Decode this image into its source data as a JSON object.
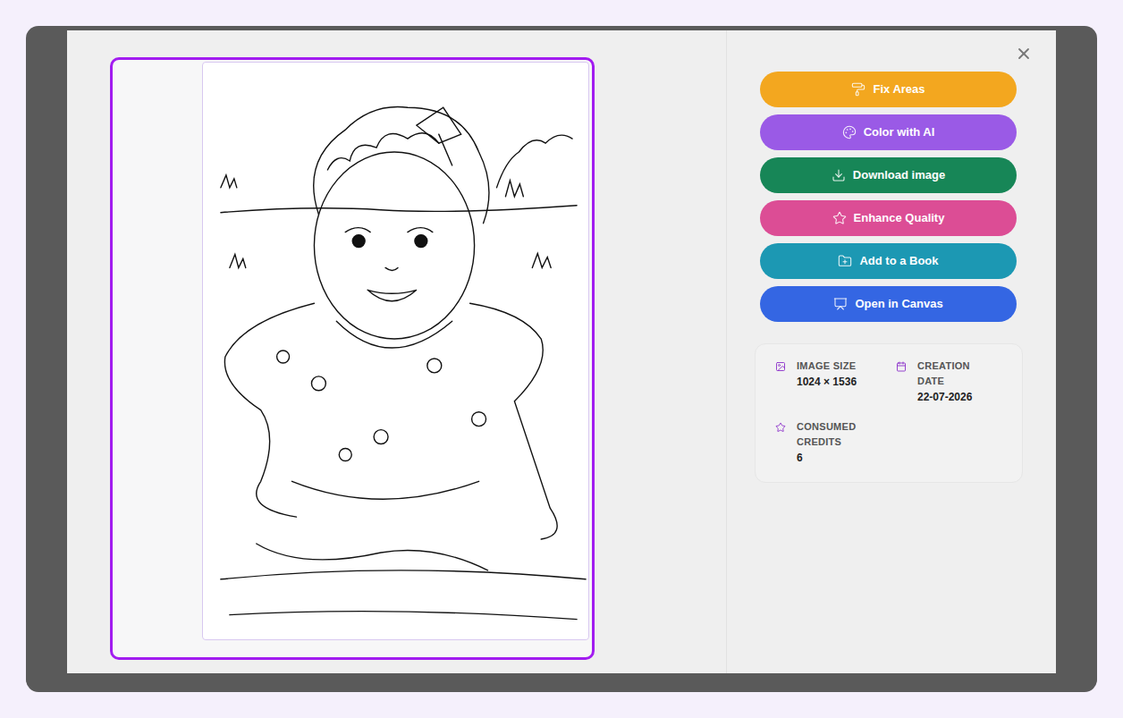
{
  "dialog": {
    "close": "close"
  },
  "actions": [
    {
      "label": "Fix Areas",
      "icon": "roller",
      "color": "#f3a71f"
    },
    {
      "label": "Color with AI",
      "icon": "palette",
      "color": "#9a5ae6"
    },
    {
      "label": "Download image",
      "icon": "download",
      "color": "#178657"
    },
    {
      "label": "Enhance Quality",
      "icon": "star",
      "color": "#dc4d95"
    },
    {
      "label": "Add to a Book",
      "icon": "folder",
      "color": "#1c98b3"
    },
    {
      "label": "Open in Canvas",
      "icon": "canvas",
      "color": "#3466e3"
    }
  ],
  "info": [
    {
      "label": "IMAGE SIZE",
      "value": "1024 × 1536",
      "icon": "image"
    },
    {
      "label": "CREATION DATE",
      "value": "22-07-2026",
      "icon": "calendar"
    },
    {
      "label": "CONSUMED CREDITS",
      "value": "6",
      "icon": "star"
    }
  ]
}
